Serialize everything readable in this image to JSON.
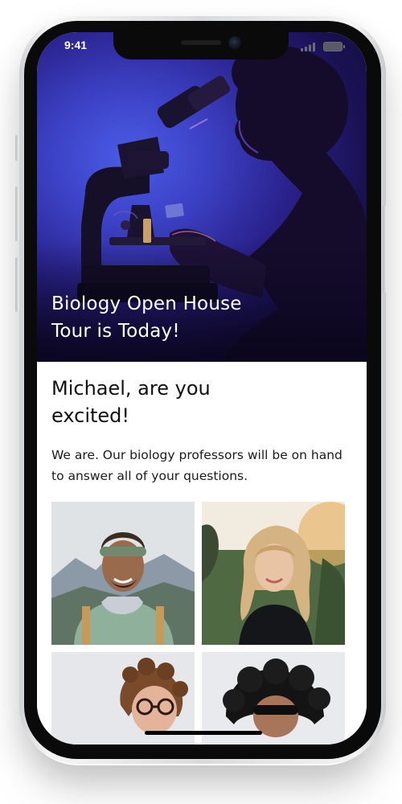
{
  "status_bar": {
    "time": "9:41"
  },
  "hero": {
    "title": "Biology Open House Tour is Today!"
  },
  "content": {
    "greeting": "Michael, are you excited!",
    "intro": "We are. Our biology professors will be on hand to answer all of your questions.",
    "professors": [
      {
        "photo": "professor-photo-1"
      },
      {
        "photo": "professor-photo-2"
      },
      {
        "photo": "professor-photo-3"
      },
      {
        "photo": "professor-photo-4"
      }
    ]
  },
  "colors": {
    "hero_blue": "#3d43c8",
    "hero_dark": "#120a2e",
    "text": "#111111",
    "frame": "#0a0a0b"
  }
}
